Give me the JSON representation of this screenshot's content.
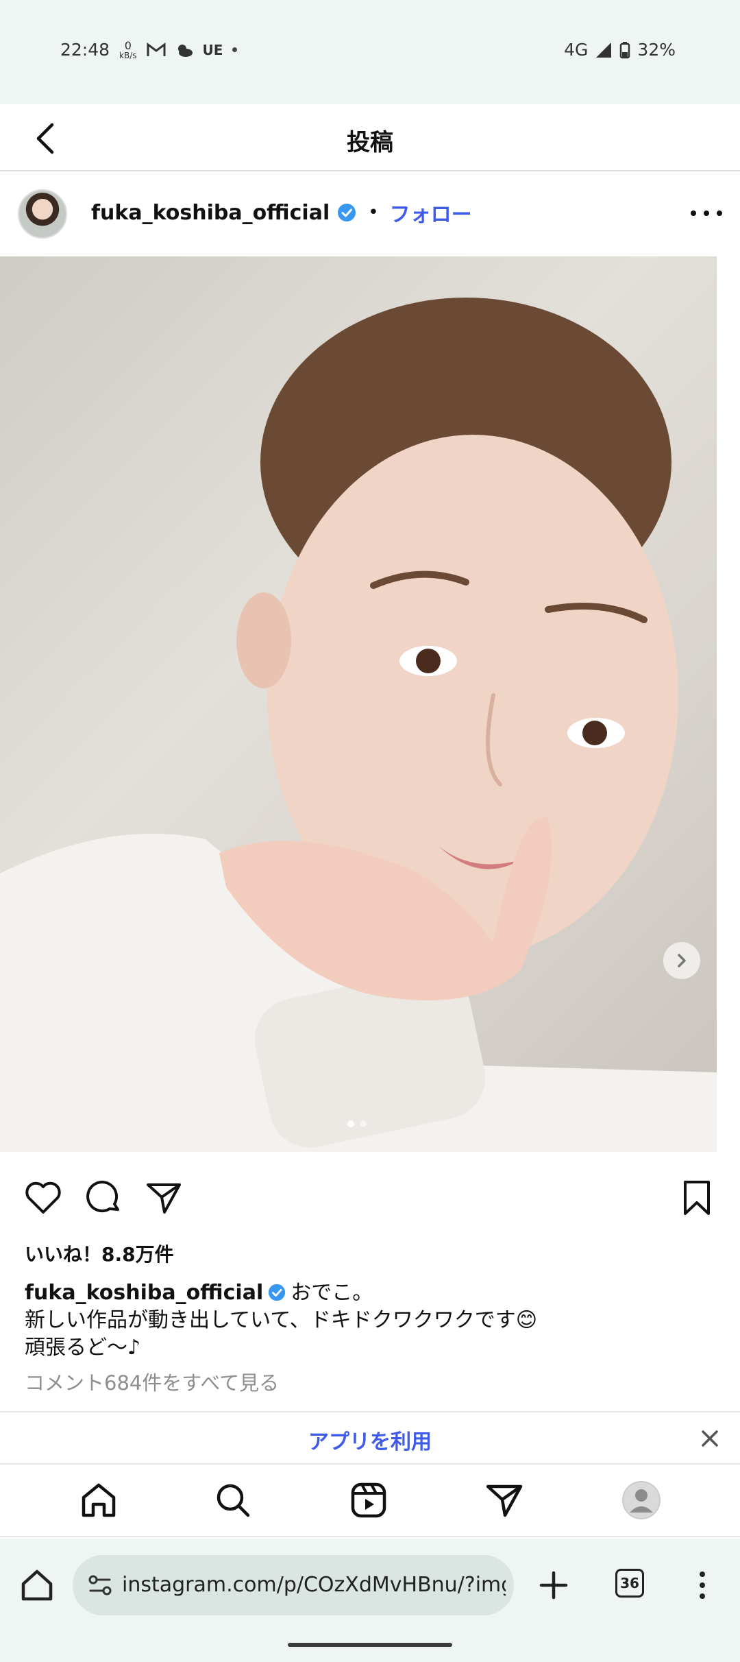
{
  "status_bar": {
    "time": "22:48",
    "speed_value": "0",
    "speed_unit": "kB/s",
    "carrier_text": "UE",
    "network": "4G",
    "battery": "32%"
  },
  "header": {
    "title": "投稿"
  },
  "post": {
    "username": "fuka_koshiba_official",
    "separator": "•",
    "follow_label": "フォロー",
    "likes": "いいね！8.8万件",
    "caption_user": "fuka_koshiba_official",
    "caption_line1": "おでこ。",
    "caption_line2": "新しい作品が動き出していて、ドキドクワクワクです😊",
    "caption_line3": "頑張るど〜♪",
    "view_comments": "コメント684件をすべて見る",
    "carousel_total": 2,
    "carousel_current": 1
  },
  "app_banner": {
    "label": "アプリを利用"
  },
  "browser": {
    "url": "instagram.com/p/COzXdMvHBnu/?img_ir",
    "tab_count": "36"
  },
  "colors": {
    "accent": "#3f5bea",
    "verified": "#3897f0",
    "status_bg": "#eef5f3"
  }
}
